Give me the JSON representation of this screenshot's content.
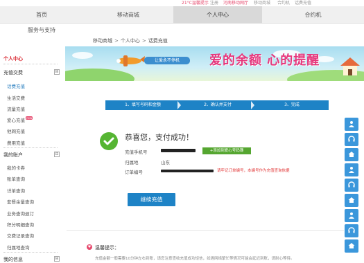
{
  "toplinks": [
    {
      "text": "21°C温馨提示",
      "hot": true
    },
    {
      "text": "注册",
      "hot": false
    },
    {
      "text": "河南移动网厅",
      "hot": true
    },
    {
      "text": "移动商城",
      "hot": false
    },
    {
      "text": "合约机",
      "hot": false
    },
    {
      "text": "话费充值",
      "hot": false
    }
  ],
  "nav": {
    "items": [
      "首页",
      "移动商城",
      "个人中心",
      "合约机"
    ],
    "active": "个人中心",
    "sub": "服务与支持"
  },
  "breadcrumb": [
    "移动商城",
    "个人中心",
    "话费充值"
  ],
  "breadcrumb_sep": ">",
  "sidebar": {
    "title": "个人中心",
    "groups": [
      {
        "label": "充值交费",
        "toggle": "⊟",
        "links": [
          {
            "text": "话费充值",
            "current": true,
            "badge": ""
          },
          {
            "text": "生活交费",
            "current": false,
            "badge": ""
          },
          {
            "text": "流量充值",
            "current": false,
            "badge": ""
          },
          {
            "text": "爱心充值",
            "current": false,
            "badge": "new"
          },
          {
            "text": "他网充值",
            "current": false,
            "badge": ""
          },
          {
            "text": "费用充值",
            "current": false,
            "badge": ""
          }
        ]
      },
      {
        "label": "我的账户",
        "toggle": "⊟",
        "links": [
          {
            "text": "我的卡券",
            "current": false,
            "badge": ""
          },
          {
            "text": "账单查询",
            "current": false,
            "badge": ""
          },
          {
            "text": "详单查询",
            "current": false,
            "badge": ""
          },
          {
            "text": "套餐余量查询",
            "current": false,
            "badge": ""
          },
          {
            "text": "业务查询退订",
            "current": false,
            "badge": ""
          },
          {
            "text": "积分明细查询",
            "current": false,
            "badge": ""
          },
          {
            "text": "交费记录查询",
            "current": false,
            "badge": ""
          },
          {
            "text": "归属地查询",
            "current": false,
            "badge": ""
          }
        ]
      },
      {
        "label": "我的信息",
        "toggle": "⊟",
        "links": []
      }
    ]
  },
  "banner": {
    "plane_text": "让爱永不停机",
    "headline": "爱的余额 心的提醒"
  },
  "steps": [
    "1、填写号码和金额",
    "2、确认并支付",
    "3、完成"
  ],
  "result": {
    "title": "恭喜您，支付成功！",
    "phone_label": "充值手机号",
    "add_button": "+添加到爱心号码簿",
    "region_label": "归属地",
    "region_value": "山东",
    "order_label": "订单编号",
    "warning": "请牢记订单编号，本编号作为充值查询依据",
    "continue_button": "继续充值"
  },
  "tips": {
    "title": "温馨提示：",
    "text": "充值金额一般需要10分钟左右到账，请您注意查收充值成功短信，如遇网络繁忙等情况可能会延迟到账，请耐心等待。"
  },
  "floatbar_icons": [
    "person-icon",
    "headset-icon",
    "home-icon",
    "person-icon",
    "headset-icon",
    "home-icon",
    "person-icon",
    "headset-icon",
    "home-icon"
  ],
  "colors": {
    "accent_blue": "#1e83c6",
    "success_green": "#56b533",
    "warning_red": "#e23a3a",
    "brand_pink": "#e64a6e"
  }
}
